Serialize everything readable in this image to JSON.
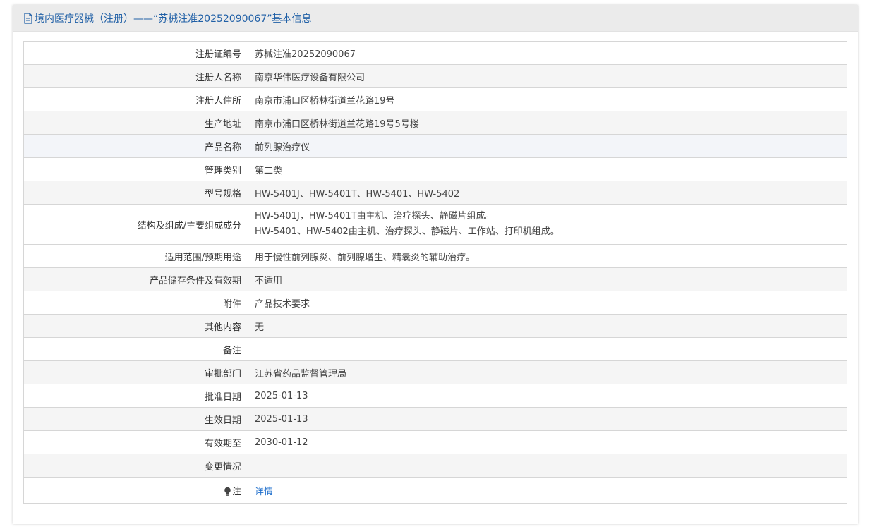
{
  "header": {
    "title": "境内医疗器械（注册）——“苏械注准20252090067”基本信息",
    "icon": "document-icon"
  },
  "colors": {
    "title_blue": "#1f5fa6",
    "link_blue": "#1f6fcc",
    "header_bg": "#ebebeb",
    "row_alt_bg": "#f5f5f5",
    "border": "#d6d6d6"
  },
  "rows": [
    {
      "label": "注册证编号",
      "value": "苏械注准20252090067"
    },
    {
      "label": "注册人名称",
      "value": "南京华伟医疗设备有限公司"
    },
    {
      "label": "注册人住所",
      "value": "南京市浦口区桥林街道兰花路19号"
    },
    {
      "label": "生产地址",
      "value": "南京市浦口区桥林街道兰花路19号5号楼"
    },
    {
      "label": "产品名称",
      "value": "前列腺治疗仪"
    },
    {
      "label": "管理类别",
      "value": "第二类"
    },
    {
      "label": "型号规格",
      "value": "HW-5401J、HW-5401T、HW-5401、HW-5402"
    },
    {
      "label": "结构及组成/主要组成成分",
      "value_line1": "HW-5401J，HW-5401T由主机、治疗探头、静磁片组成。",
      "value_line2": "HW-5401、HW-5402由主机、治疗探头、静磁片、工作站、打印机组成。"
    },
    {
      "label": "适用范围/预期用途",
      "value": "用于慢性前列腺炎、前列腺增生、精囊炎的辅助治疗。"
    },
    {
      "label": "产品储存条件及有效期",
      "value": "不适用"
    },
    {
      "label": "附件",
      "value": "产品技术要求"
    },
    {
      "label": "其他内容",
      "value": "无"
    },
    {
      "label": "备注",
      "value": ""
    },
    {
      "label": "审批部门",
      "value": "江苏省药品监督管理局"
    },
    {
      "label": "批准日期",
      "value": "2025-01-13"
    },
    {
      "label": "生效日期",
      "value": "2025-01-13"
    },
    {
      "label": "有效期至",
      "value": "2030-01-12"
    },
    {
      "label": "变更情况",
      "value": ""
    },
    {
      "label": "注",
      "label_icon": "lightbulb-icon",
      "value": "详情"
    }
  ]
}
